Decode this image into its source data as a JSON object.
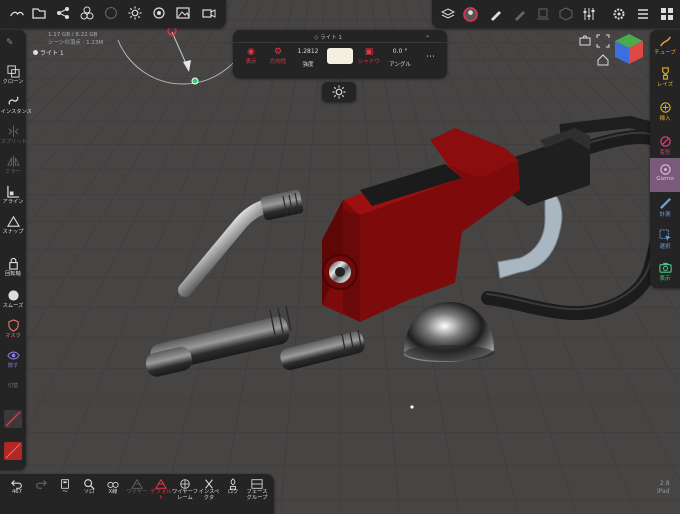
{
  "scene_info": {
    "memory": "1.17 GB / 8.22 GB",
    "scene_vertices": "シーンの頂点 : 1.23M",
    "active_light": "ライト 1"
  },
  "light_popup": {
    "title": "ライト 1",
    "show_label": "表示",
    "direction_label": "方向性",
    "intensity_value": "1.2812",
    "intensity_label": "強度",
    "shadow_label": "シャドウ",
    "angle_value": "0.0 °",
    "angle_label": "アングル",
    "light_color": "#f2eee0"
  },
  "left_toolbar": {
    "items": [
      {
        "label": "クローン",
        "icon": "clone-icon"
      },
      {
        "label": "インスタンス",
        "icon": "instance-icon"
      },
      {
        "label": "スプリット",
        "icon": "split-icon"
      },
      {
        "label": "ミラー",
        "icon": "mirror-icon"
      },
      {
        "label": "アライン",
        "icon": "align-icon"
      },
      {
        "label": "スナップ",
        "icon": "snap-icon"
      },
      {
        "label": "回転軸",
        "icon": "pivot-icon"
      },
      {
        "label": "スムーズ",
        "icon": "smooth-icon"
      },
      {
        "label": "マスク",
        "icon": "mask-icon"
      },
      {
        "label": "隠す",
        "icon": "hide-icon"
      },
      {
        "label": "切替",
        "icon": "toggle-icon"
      }
    ]
  },
  "right_toolbar": {
    "items": [
      {
        "label": "チューブ",
        "icon": "tube-icon"
      },
      {
        "label": "レイズ",
        "icon": "raise-icon"
      },
      {
        "label": "挿入",
        "icon": "insert-icon"
      },
      {
        "label": "変形",
        "icon": "transform-icon"
      },
      {
        "label": "Gizmo",
        "icon": "gizmo-icon"
      },
      {
        "label": "計測",
        "icon": "measure-icon"
      },
      {
        "label": "選択",
        "icon": "select-icon"
      },
      {
        "label": "表示",
        "icon": "camera-icon"
      }
    ]
  },
  "bottom_toolbar": {
    "undo_count": "467",
    "items": [
      {
        "label": "〜",
        "icon": "layers-icon"
      },
      {
        "label": "ソロ",
        "icon": "search-icon"
      },
      {
        "label": "X線",
        "icon": "xray-icon"
      },
      {
        "label": "ワイヤー",
        "icon": "wire-icon"
      },
      {
        "label": "デフォルト",
        "icon": "default-icon"
      },
      {
        "label": "ワイヤーフレーム",
        "icon": "wireframe-icon"
      },
      {
        "label": "インスペクタ",
        "icon": "inspector-icon"
      },
      {
        "label": "ロク",
        "icon": "lock-icon"
      },
      {
        "label": "フェースグループ",
        "icon": "facegroup-icon"
      }
    ]
  },
  "corner_info": {
    "version": "2.8",
    "device": "iPad"
  },
  "colors": {
    "accent_red": "#e0384a",
    "accent_orange": "#e6ad2a",
    "panel_bg": "#242424",
    "viewport_bg": "#474444"
  }
}
